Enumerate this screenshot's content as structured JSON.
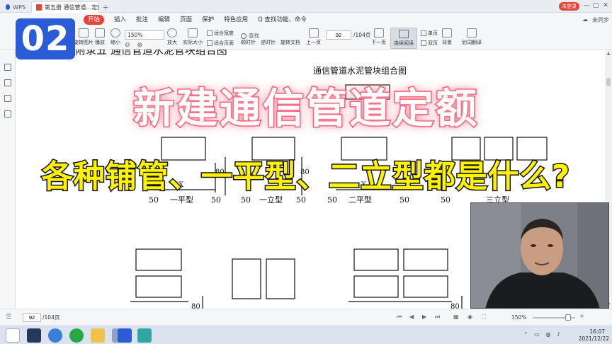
{
  "titlebar": {
    "app_tab": "WPS",
    "doc_tab": "第五册 通信管道...定额.pdf",
    "login": "未登录"
  },
  "menu": {
    "items": [
      "开始",
      "插入",
      "批注",
      "编辑",
      "页面",
      "保护",
      "特色应用"
    ],
    "search": "Q 查找功能、命令",
    "right": [
      "未同步"
    ]
  },
  "toolbar": {
    "buttons": [
      "旋转图片",
      "播放",
      "缩小",
      "放大",
      "实际大小",
      "顺时针",
      "逆时针",
      "旋转文档",
      "上一页",
      "下一页",
      "连续阅读",
      "单页",
      "双页",
      "背景",
      "划词翻译"
    ],
    "zoom_value": "150%",
    "fit_width": "适合宽度",
    "fit_page": "适合页面",
    "search_placeholder": "查找",
    "page_current": "92",
    "page_total": "/104页"
  },
  "document": {
    "header_text": "附录五  通信管道水泥管块组合图",
    "figure_title": "通信管道水泥管块组合图",
    "dim_80": "80",
    "dim_50": "50",
    "dim_x": "X",
    "labels": [
      "一平型",
      "一立型",
      "二平型",
      "三立型"
    ]
  },
  "overlay": {
    "badge": "02",
    "headline": "新建通信管道定额",
    "subtitle": "各种铺管、一平型、二立型都是什么?"
  },
  "statusbar": {
    "page_current": "92",
    "page_total": "/104页",
    "zoom": "150%"
  },
  "taskbar": {
    "time": "16:07",
    "date": "2021/12/22"
  },
  "colors": {
    "accent_red": "#e8443a",
    "headline_stroke": "#e9506a",
    "subtitle_fill": "#fff200",
    "badge_blue": "#2a5cd8"
  }
}
